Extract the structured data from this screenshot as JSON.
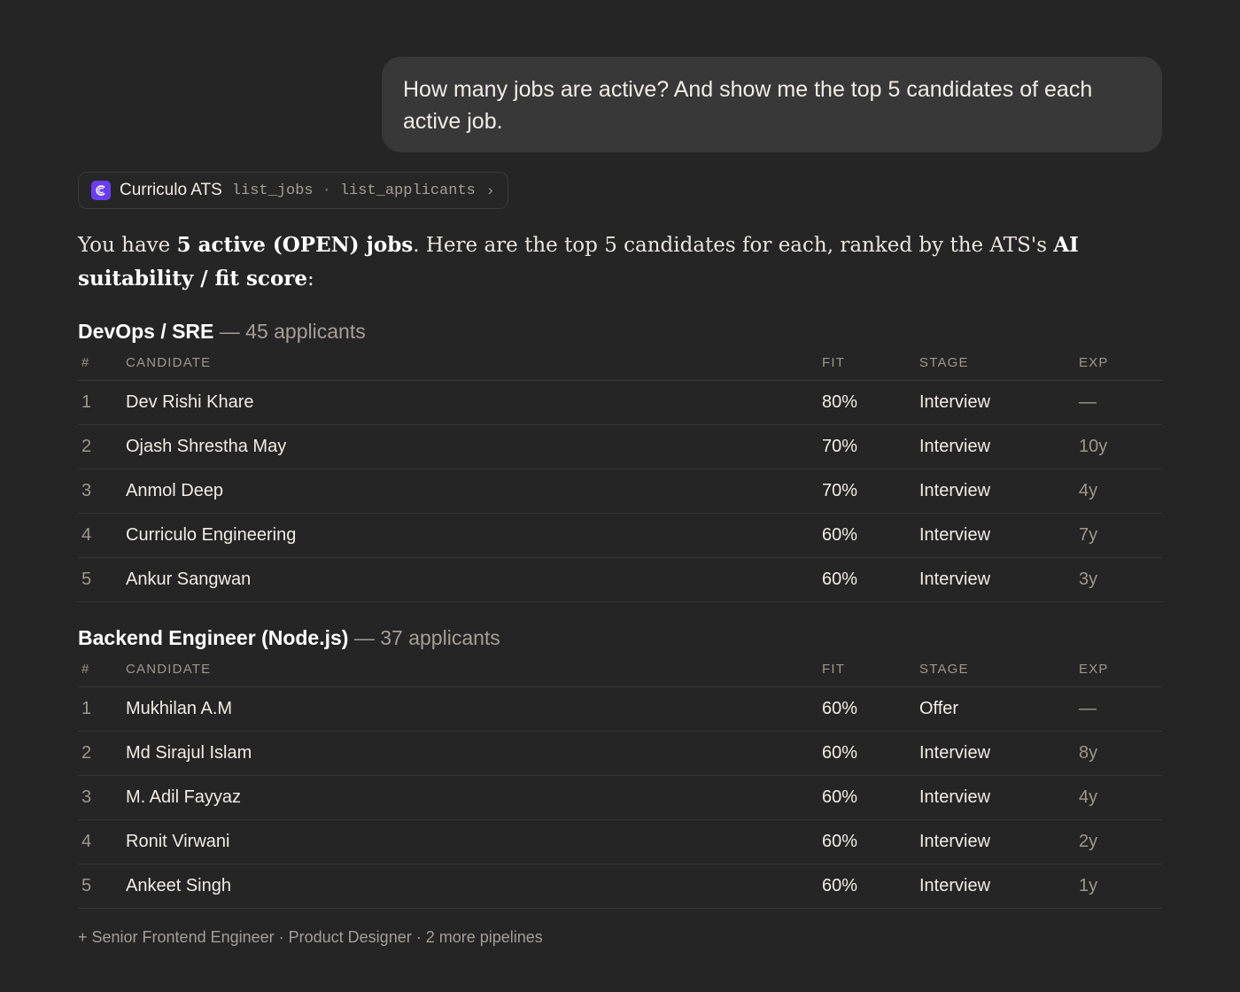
{
  "user_message": "How many jobs are active? And show me the top 5 candidates of each active job.",
  "tool_call": {
    "app_name": "Curriculo ATS",
    "logo_icon": "curriculo-logo-icon",
    "logo_color": "#6a3df5",
    "calls": [
      "list_jobs",
      "list_applicants"
    ],
    "separator": "·",
    "chevron": "›"
  },
  "answer": {
    "pre": "You have ",
    "bold_1": "5 active (OPEN) jobs",
    "mid": ". Here are the top 5 candidates for each, ranked by the ATS's ",
    "bold_2": "AI suitability / fit score",
    "post": ":"
  },
  "jobs": [
    {
      "title": "DevOps / SRE",
      "dash": " — ",
      "applicants": "45 applicants",
      "columns": {
        "num": "#",
        "candidate": "CANDIDATE",
        "fit": "FIT",
        "stage": "STAGE",
        "exp": "EXP"
      },
      "rows": [
        {
          "rank": "1",
          "name": "Dev Rishi Khare",
          "fit": "80%",
          "stage": "Interview",
          "exp": "—"
        },
        {
          "rank": "2",
          "name": "Ojash Shrestha May",
          "fit": "70%",
          "stage": "Interview",
          "exp": "10y"
        },
        {
          "rank": "3",
          "name": "Anmol Deep",
          "fit": "70%",
          "stage": "Interview",
          "exp": "4y"
        },
        {
          "rank": "4",
          "name": "Curriculo Engineering",
          "fit": "60%",
          "stage": "Interview",
          "exp": "7y"
        },
        {
          "rank": "5",
          "name": "Ankur Sangwan",
          "fit": "60%",
          "stage": "Interview",
          "exp": "3y"
        }
      ]
    },
    {
      "title": "Backend Engineer (Node.js)",
      "dash": " — ",
      "applicants": "37 applicants",
      "columns": {
        "num": "#",
        "candidate": "CANDIDATE",
        "fit": "FIT",
        "stage": "STAGE",
        "exp": "EXP"
      },
      "rows": [
        {
          "rank": "1",
          "name": "Mukhilan A.M",
          "fit": "60%",
          "stage": "Offer",
          "exp": "—"
        },
        {
          "rank": "2",
          "name": "Md Sirajul Islam",
          "fit": "60%",
          "stage": "Interview",
          "exp": "8y"
        },
        {
          "rank": "3",
          "name": "M. Adil Fayyaz",
          "fit": "60%",
          "stage": "Interview",
          "exp": "4y"
        },
        {
          "rank": "4",
          "name": "Ronit Virwani",
          "fit": "60%",
          "stage": "Interview",
          "exp": "2y"
        },
        {
          "rank": "5",
          "name": "Ankeet Singh",
          "fit": "60%",
          "stage": "Interview",
          "exp": "1y"
        }
      ]
    }
  ],
  "footer": "+ Senior Frontend Engineer · Product Designer · 2 more pipelines"
}
